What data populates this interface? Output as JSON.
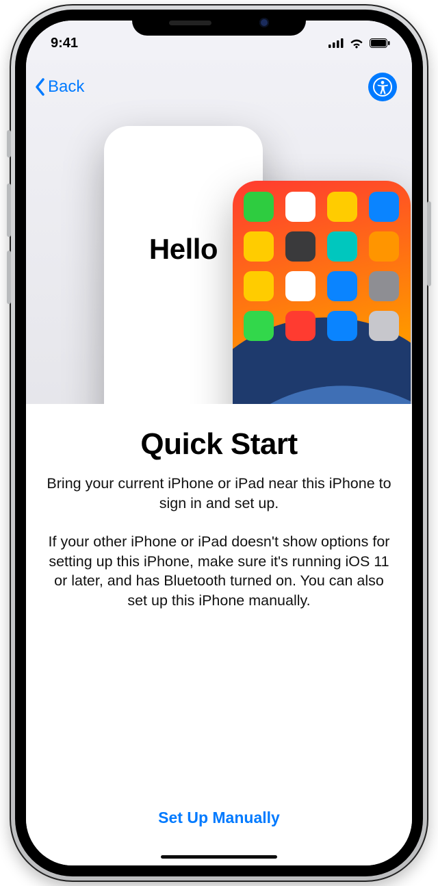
{
  "status": {
    "time": "9:41"
  },
  "nav": {
    "back_label": "Back"
  },
  "mock": {
    "hello_label": "Hello"
  },
  "content": {
    "title": "Quick Start",
    "line1": "Bring your current iPhone or iPad near this iPhone to sign in and set up.",
    "line2": "If your other iPhone or iPad doesn't show options for setting up this iPhone, make sure it's running iOS 11 or later, and has Bluetooth turned on. You can also set up this iPhone manually."
  },
  "footer": {
    "manual_label": "Set Up Manually"
  },
  "colors": {
    "accent": "#007aff",
    "app_icons": [
      "#2ecc40",
      "#ffffff",
      "#ffcc00",
      "#0a84ff",
      "#ffcc00",
      "#3a3a3c",
      "#00c7be",
      "#ff9500",
      "#ffcc00",
      "#ffffff",
      "#0a84ff",
      "#8e8e93",
      "#32d74b",
      "#ff3b30",
      "#0a84ff",
      "#c7c7cc"
    ]
  }
}
